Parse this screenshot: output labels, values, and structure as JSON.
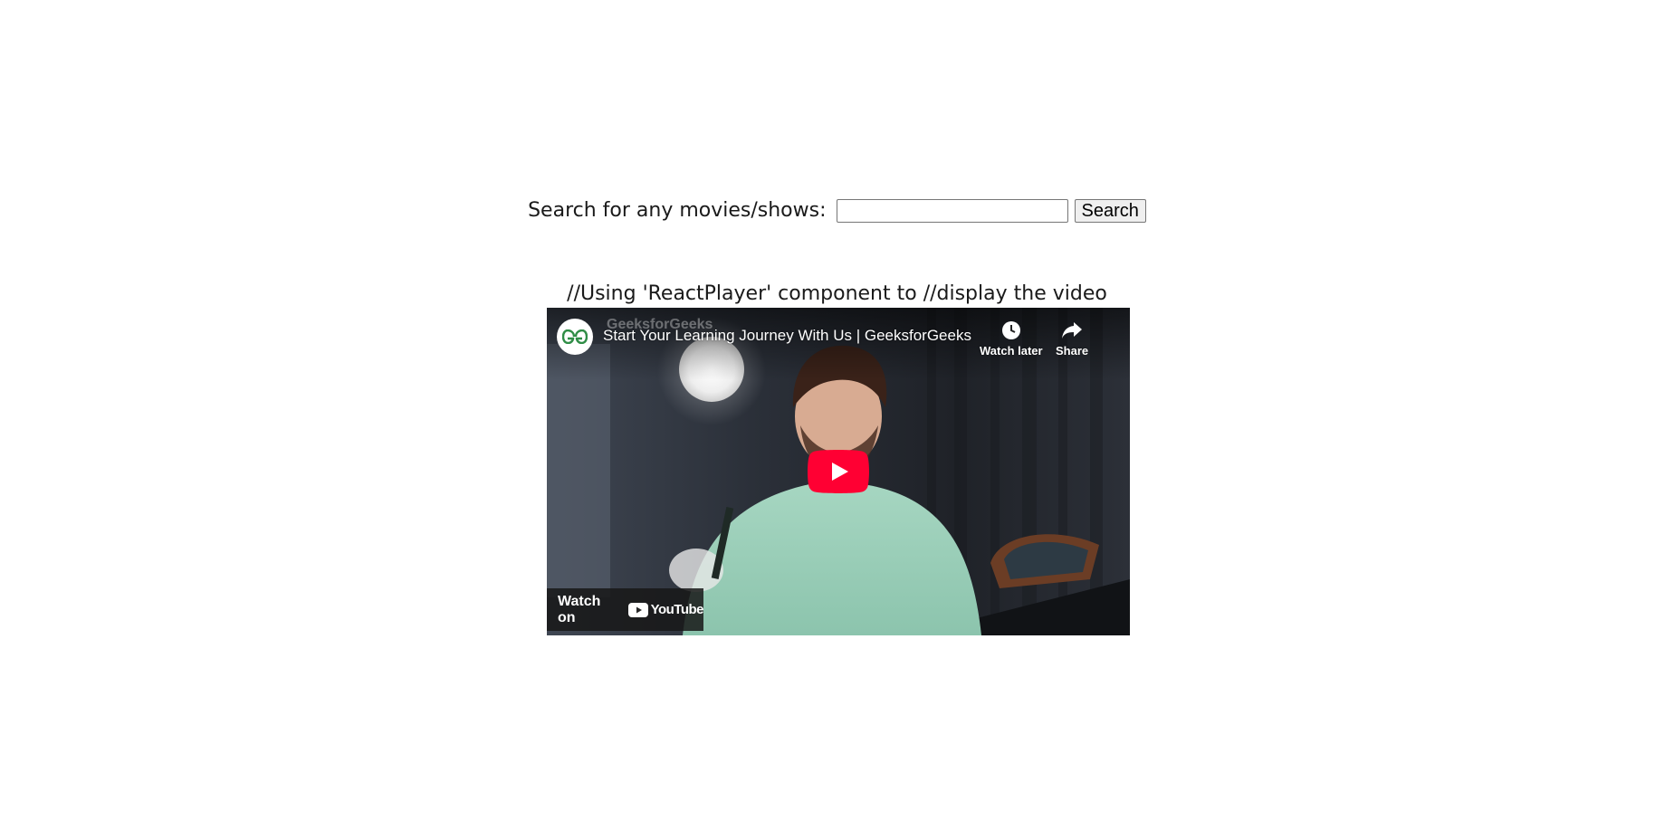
{
  "search": {
    "label": "Search for any movies/shows:",
    "value": "",
    "placeholder": "",
    "button_label": "Search"
  },
  "comment_text": "//Using 'ReactPlayer' component to //display the video",
  "player": {
    "channel_name": "GeeksforGeeks",
    "title": "Start Your Learning Journey With Us | GeeksforGeeks",
    "watch_later_label": "Watch later",
    "share_label": "Share",
    "watch_on_label": "Watch on",
    "youtube_logo_text": "YouTube",
    "channel_logo_text": "GG",
    "icons": {
      "watch_later": "clock-icon",
      "share": "share-arrow-icon",
      "play": "play-icon"
    },
    "colors": {
      "play_button": "#ff0033",
      "channel_logo": "#2f8d46"
    }
  }
}
